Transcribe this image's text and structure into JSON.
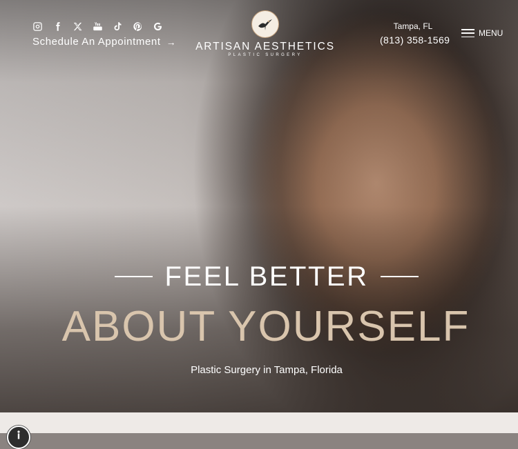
{
  "header": {
    "social_icons": [
      "instagram-icon",
      "facebook-icon",
      "x-icon",
      "youtube-icon",
      "tiktok-icon",
      "pinterest-icon",
      "google-icon"
    ],
    "schedule_label": "Schedule An Appointment",
    "schedule_arrow": "→",
    "logo": {
      "name": "ARTISAN AESTHETICS",
      "subtitle": "PLASTIC SURGERY"
    },
    "location": "Tampa, FL",
    "phone": "(813) 358-1569",
    "menu_label": "MENU"
  },
  "hero": {
    "headline_line1": "FEEL BETTER",
    "headline_line2": "ABOUT YOURSELF",
    "tagline": "Plastic Surgery in Tampa, Florida",
    "accent_color": "#d9c5ad"
  },
  "accessibility": {
    "icon": "accessibility-icon"
  }
}
